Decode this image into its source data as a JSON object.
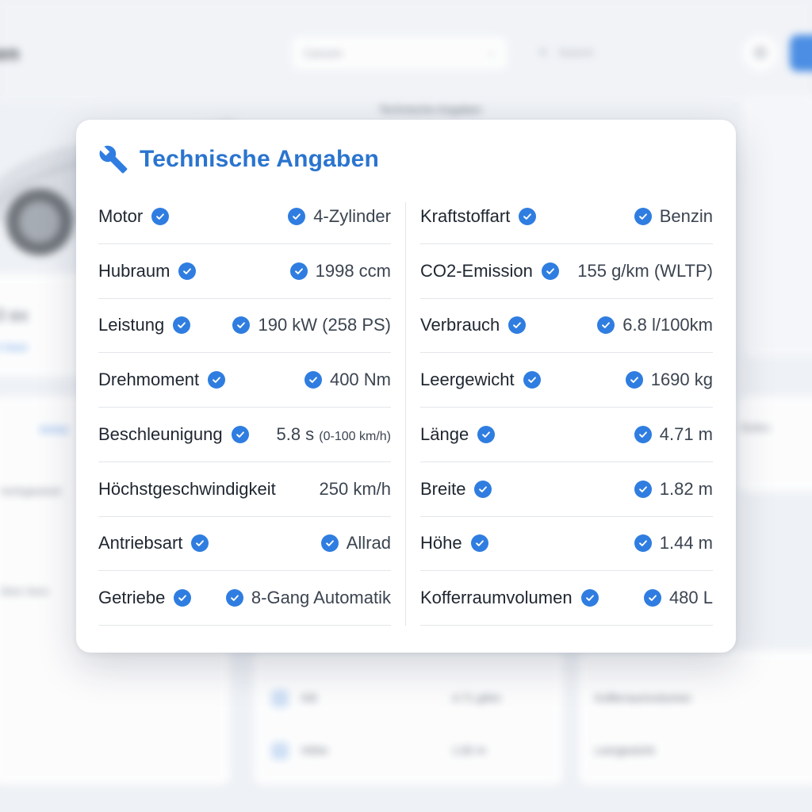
{
  "background": {
    "brand": "en",
    "select_value": "Carsom",
    "search_placeholder": "Search",
    "panel_title": "Technische Angaben",
    "price": "0 ex",
    "price_link": "S Seed",
    "left_link": "Achse",
    "left_text_1": "Verfügbarkeit",
    "left_text_2": "Sitze Sess",
    "right_mid_text": "Reifen",
    "lower_rows": [
      {
        "label": "Kilt",
        "value": "4.71 g/km"
      },
      {
        "label": "Höhe",
        "value": "1.82 m"
      }
    ],
    "lower_right_rows": [
      "Kofferraumvolumen",
      "Leergewicht"
    ]
  },
  "card": {
    "title": "Technische Angaben",
    "icon": "wrench-icon",
    "accent_color": "#2a74cf",
    "check_color": "#2f7de0",
    "left_specs": [
      {
        "label": "Motor",
        "label_check": true,
        "value": "4-Zylinder",
        "value_check": true
      },
      {
        "label": "Hubraum",
        "label_check": true,
        "value": "1998 ccm",
        "value_check": true
      },
      {
        "label": "Leistung",
        "label_check": true,
        "value": "190 kW (258 PS)",
        "value_check": true
      },
      {
        "label": "Drehmoment",
        "label_check": true,
        "value": "400 Nm",
        "value_check": true
      },
      {
        "label": "Beschleunigung",
        "label_check": true,
        "value": "5.8 s",
        "value_sub": "(0-100 km/h)",
        "value_check": false
      },
      {
        "label": "Höchstgeschwindigkeit",
        "label_check": false,
        "value": "250 km/h",
        "value_check": false
      },
      {
        "label": "Antriebsart",
        "label_check": true,
        "value": "Allrad",
        "value_check": true
      },
      {
        "label": "Getriebe",
        "label_check": true,
        "value": "8-Gang Automatik",
        "value_check": true
      }
    ],
    "right_specs": [
      {
        "label": "Kraftstoffart",
        "label_check": true,
        "value": "Benzin",
        "value_check": true
      },
      {
        "label": "CO2-Emission",
        "label_check": true,
        "value": "155 g/km (WLTP)",
        "value_check": false
      },
      {
        "label": "Verbrauch",
        "label_check": true,
        "value": "6.8 l/100km",
        "value_check": true
      },
      {
        "label": "Leergewicht",
        "label_check": true,
        "value": "1690 kg",
        "value_check": true
      },
      {
        "label": "Länge",
        "label_check": true,
        "value": "4.71 m",
        "value_check": true
      },
      {
        "label": "Breite",
        "label_check": true,
        "value": "1.82 m",
        "value_check": true
      },
      {
        "label": "Höhe",
        "label_check": true,
        "value": "1.44 m",
        "value_check": true
      },
      {
        "label": "Kofferraumvolumen",
        "label_check": true,
        "value": "480 L",
        "value_check": true
      }
    ]
  }
}
